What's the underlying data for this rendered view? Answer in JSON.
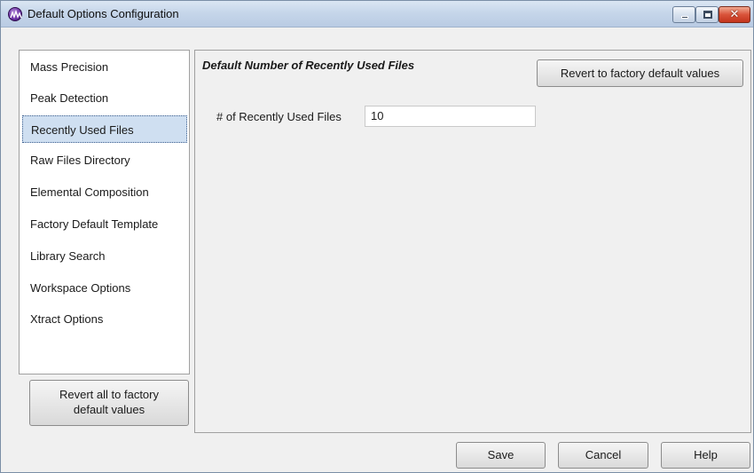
{
  "window": {
    "title": "Default Options Configuration",
    "controls": {
      "minimize": "minimize",
      "maximize": "maximize",
      "close": "✕"
    }
  },
  "sidebar": {
    "selected_index": 2,
    "items": [
      {
        "label": "Mass Precision"
      },
      {
        "label": "Peak Detection"
      },
      {
        "label": "Recently Used Files"
      },
      {
        "label": "Raw Files Directory"
      },
      {
        "label": "Elemental Composition"
      },
      {
        "label": "Factory Default Template"
      },
      {
        "label": "Library Search"
      },
      {
        "label": "Workspace Options"
      },
      {
        "label": "Xtract Options"
      }
    ],
    "revert_all_label_line1": "Revert all to factory",
    "revert_all_label_line2": "default values"
  },
  "content": {
    "title": "Default Number of Recently Used Files",
    "revert_button_label": "Revert to factory default values",
    "field_label": "# of Recently Used Files",
    "field_value": "10"
  },
  "footer": {
    "save_label": "Save",
    "cancel_label": "Cancel",
    "help_label": "Help"
  },
  "colors": {
    "selection_background": "#cfdff1",
    "close_button": "#d9533a"
  }
}
